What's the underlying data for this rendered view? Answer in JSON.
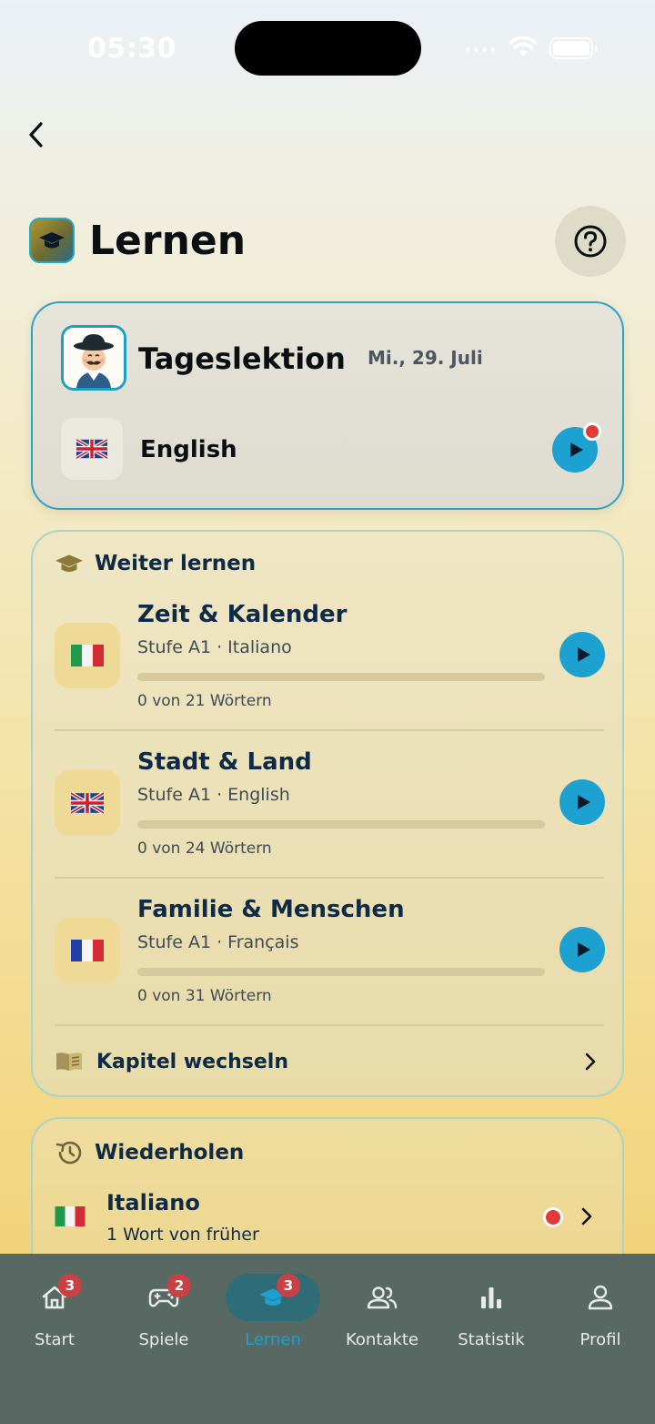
{
  "status_bar": {
    "time": "05:30"
  },
  "header": {
    "title": "Lernen",
    "back_icon": "chevron-left-icon",
    "help_icon": "question-circle-icon"
  },
  "daily": {
    "title": "Tageslektion",
    "date": "Mi., 29. Juli",
    "language": "English",
    "flag": "uk-flag-icon",
    "has_notification": true
  },
  "continue": {
    "title": "Weiter lernen",
    "lessons": [
      {
        "title": "Zeit & Kalender",
        "subtitle": "Stufe A1 · Italiano",
        "count": "0 von 21 Wörtern",
        "progress": 0,
        "flag": "italy-flag-icon"
      },
      {
        "title": "Stadt & Land",
        "subtitle": "Stufe A1 · English",
        "count": "0 von 24 Wörtern",
        "progress": 0,
        "flag": "uk-flag-icon"
      },
      {
        "title": "Familie & Menschen",
        "subtitle": "Stufe A1 · Français",
        "count": "0 von 31 Wörtern",
        "progress": 0,
        "flag": "france-flag-icon"
      }
    ],
    "change_chapter": "Kapitel wechseln"
  },
  "review": {
    "title": "Wiederholen",
    "items": [
      {
        "language": "Italiano",
        "subtitle": "1 Wort von früher",
        "flag": "italy-flag-icon"
      }
    ]
  },
  "tabs": [
    {
      "label": "Start",
      "badge": "3",
      "icon": "home-icon"
    },
    {
      "label": "Spiele",
      "badge": "2",
      "icon": "gamepad-icon"
    },
    {
      "label": "Lernen",
      "badge": "3",
      "icon": "graduation-cap-icon",
      "active": true
    },
    {
      "label": "Kontakte",
      "badge": "",
      "icon": "contacts-icon"
    },
    {
      "label": "Statistik",
      "badge": "",
      "icon": "bar-chart-icon"
    },
    {
      "label": "Profil",
      "badge": "",
      "icon": "profile-icon"
    }
  ],
  "colors": {
    "accent": "#1da1d0",
    "notification": "#e23a3a",
    "tabbar": "#586863"
  }
}
